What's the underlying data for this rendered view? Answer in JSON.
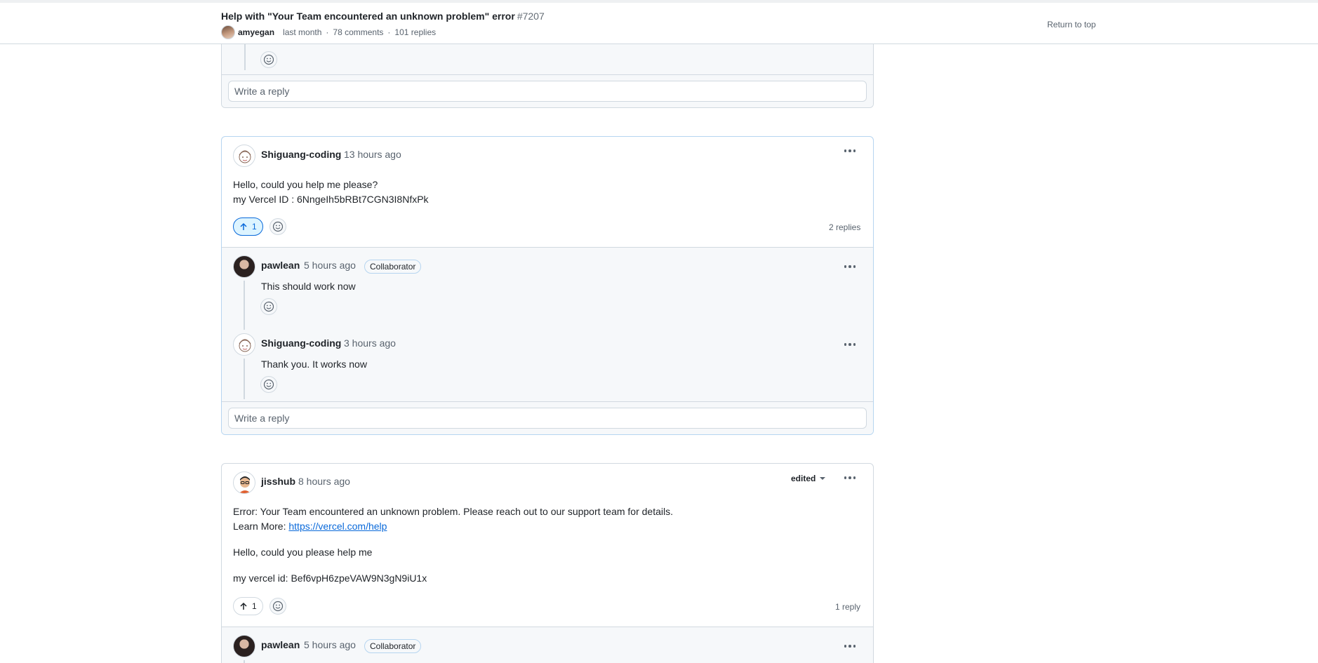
{
  "header": {
    "title": "Help with \"Your Team encountered an unknown problem\" error",
    "number": "#7207",
    "author": "amyegan",
    "time": "last month",
    "comments": "78 comments",
    "replies": "101 replies",
    "return_to_top": "Return to top"
  },
  "reply_placeholder": "Write a reply",
  "comment1": {
    "author": "Shiguang-coding",
    "time": "13 hours ago",
    "line1": "Hello, could you help me please?",
    "line2": "my Vercel ID : 6NngeIh5bRBt7CGN3I8NfxPk",
    "upvotes": "1",
    "reply_count": "2 replies",
    "replies": [
      {
        "author": "pawlean",
        "time": "5 hours ago",
        "badge": "Collaborator",
        "text": "This should work now"
      },
      {
        "author": "Shiguang-coding",
        "time": "3 hours ago",
        "text": "Thank you. It works now"
      }
    ]
  },
  "comment2": {
    "author": "jisshub",
    "time": "8 hours ago",
    "edited": "edited",
    "line1": "Error: Your Team encountered an unknown problem. Please reach out to our support team for details.",
    "line2_prefix": "Learn More: ",
    "line2_link": "https://vercel.com/help",
    "line3": "Hello, could you please help me",
    "line4": "my vercel id: Bef6vpH6zpeVAW9N3gN9iU1x",
    "upvotes": "1",
    "reply_count": "1 reply",
    "reply": {
      "author": "pawlean",
      "time": "5 hours ago",
      "badge": "Collaborator"
    }
  },
  "colors": {
    "accent": "#0969da",
    "upvote_active_bg": "#ddf4ff",
    "border": "#d1d9e0"
  },
  "icons": [
    "smiley-icon",
    "arrow-up-icon",
    "kebab-horizontal-icon",
    "triangle-down-icon"
  ]
}
